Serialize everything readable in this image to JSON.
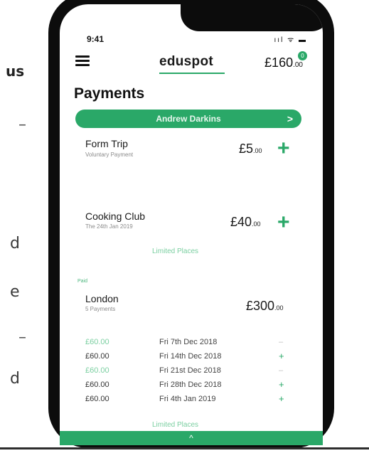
{
  "background_text": {
    "us": "us",
    "dash1": "–",
    "d1": "d",
    "e": "e",
    "dash2": "–",
    "d2": "d"
  },
  "status": {
    "time": "9:41",
    "icons": "ııl ᯤ ▬"
  },
  "header": {
    "logo": "eduspot",
    "balance": "£160",
    "balance_pence": ".00",
    "badge": "0"
  },
  "page_title": "Payments",
  "child_selector": {
    "name": "Andrew Darkins",
    "chevron": ">"
  },
  "items": [
    {
      "name": "Form Trip",
      "sub": "Voluntary Payment",
      "price": "£5",
      "pence": ".00"
    },
    {
      "name": "Cooking Club",
      "sub": "The 24th Jan 2019",
      "price": "£40",
      "pence": ".00",
      "note": "Limited Places"
    },
    {
      "tag": "Paid",
      "name": "London",
      "sub": "5 Payments",
      "price": "£300",
      "pence": ".00"
    }
  ],
  "schedule": [
    {
      "amount": "£60.00",
      "date": "Fri 7th Dec 2018",
      "action": "–",
      "paid": true
    },
    {
      "amount": "£60.00",
      "date": "Fri 14th Dec 2018",
      "action": "+",
      "paid": false
    },
    {
      "amount": "£60.00",
      "date": "Fri 21st Dec 2018",
      "action": "–",
      "paid": true
    },
    {
      "amount": "£60.00",
      "date": "Fri 28th Dec 2018",
      "action": "+",
      "paid": false
    },
    {
      "amount": "£60.00",
      "date": "Fri 4th Jan 2019",
      "action": "+",
      "paid": false
    }
  ],
  "limited_bottom": "Limited Places",
  "bottom_bar": {
    "chevron": "^"
  },
  "colors": {
    "accent": "#2aa868",
    "accent_light": "#7bcfa1"
  }
}
